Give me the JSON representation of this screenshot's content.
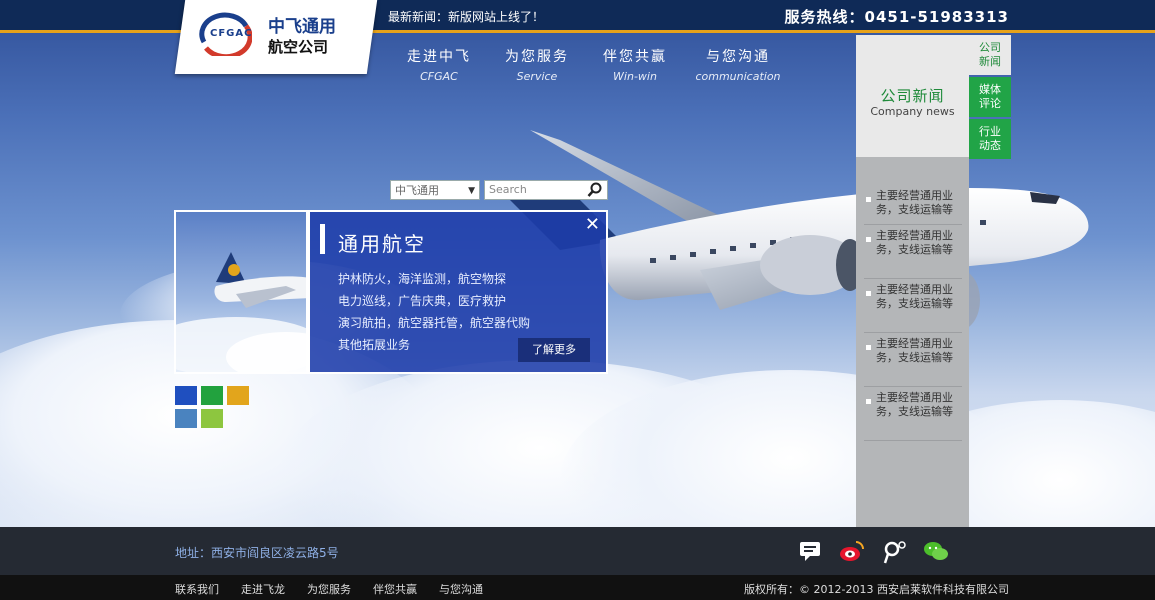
{
  "topbar": {
    "news": "最新新闻：新版网站上线了！",
    "hotline": "服务热线：0451-51983313"
  },
  "logo": {
    "en": "CFGAC",
    "cn_line1": "中飞通用",
    "cn_line2": "航空公司"
  },
  "nav": [
    {
      "cn": "走进中飞",
      "en": "CFGAC"
    },
    {
      "cn": "为您服务",
      "en": "Service"
    },
    {
      "cn": "伴您共赢",
      "en": "Win-win"
    },
    {
      "cn": "与您沟通",
      "en": "communication"
    }
  ],
  "search": {
    "select_value": "中飞通用",
    "placeholder": "Search"
  },
  "feature": {
    "title": "通用航空",
    "lines": [
      "护林防火，海洋监测，航空物探",
      "电力巡线，广告庆典，医疗救护",
      "演习航拍，航空器托管，航空器代购",
      "其他拓展业务"
    ],
    "more": "了解更多",
    "close": "✕"
  },
  "swatches": {
    "colors": [
      "#1f4fbf",
      "#22a23e",
      "#e2a51c",
      "#4a83bf",
      "#8dc63f"
    ]
  },
  "side": {
    "head_cn": "公司新闻",
    "head_en": "Company news",
    "items": [
      "主要经营通用业务，支线运输等",
      "主要经营通用业务，支线运输等",
      "主要经营通用业务，支线运输等",
      "主要经营通用业务，支线运输等",
      "主要经营通用业务，支线运输等"
    ]
  },
  "tabs": [
    {
      "label_l1": "公司",
      "label_l2": "新闻"
    },
    {
      "label_l1": "媒体",
      "label_l2": "评论"
    },
    {
      "label_l1": "行业",
      "label_l2": "动态"
    }
  ],
  "footer": {
    "address": "地址：西安市阎良区凌云路5号",
    "social_icons": [
      "message-icon",
      "weibo-icon",
      "tencent-weibo-icon",
      "wechat-icon"
    ],
    "links": [
      "联系我们",
      "走进飞龙",
      "为您服务",
      "伴您共赢",
      "与您沟通"
    ],
    "copyright": "版权所有：© 2012-2013 西安启莱软件科技有限公司"
  }
}
